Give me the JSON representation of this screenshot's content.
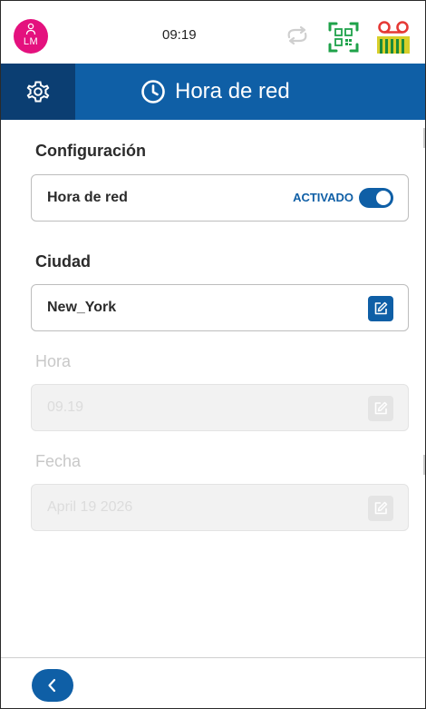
{
  "status_bar": {
    "avatar_initials": "LM",
    "time": "09:19",
    "avatar_color": "#e4117e"
  },
  "header": {
    "title": "Hora de red",
    "icons": [
      "gear-icon",
      "clock-icon"
    ],
    "color": "#0f5fa6"
  },
  "configuracion": {
    "heading": "Configuración",
    "network_time_label": "Hora de red",
    "toggle_state": "ACTIVADO",
    "toggle_on": true
  },
  "ciudad": {
    "heading": "Ciudad",
    "value": "New_York"
  },
  "hora": {
    "heading": "Hora",
    "value": "09.19",
    "disabled": true
  },
  "fecha": {
    "heading": "Fecha",
    "value": "April 19 2026",
    "disabled": true
  },
  "footer": {
    "back_icon": "chevron-left-icon"
  }
}
